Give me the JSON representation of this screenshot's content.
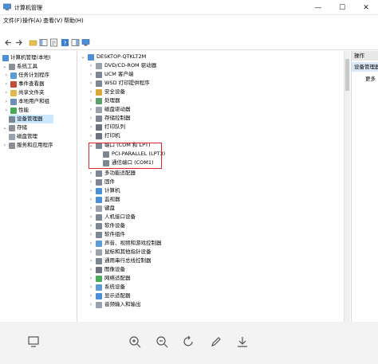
{
  "window": {
    "title": "计算机管理",
    "min_glyph": "—",
    "max_glyph": "☐",
    "close_glyph": "✕"
  },
  "menu": {
    "items": [
      "文件(F)",
      "操作(A)",
      "查看(V)",
      "帮助(H)"
    ]
  },
  "left_tree": {
    "items": [
      {
        "label": "计算机管理(本地)",
        "selected": false
      },
      {
        "label": "系统工具",
        "selected": false
      },
      {
        "label": "任务计划程序",
        "selected": false
      },
      {
        "label": "事件查看器",
        "selected": false
      },
      {
        "label": "共享文件夹",
        "selected": false
      },
      {
        "label": "本地用户和组",
        "selected": false
      },
      {
        "label": "性能",
        "selected": false
      },
      {
        "label": "设备管理器",
        "selected": true
      },
      {
        "label": "存储",
        "selected": false
      },
      {
        "label": "磁盘管理",
        "selected": false
      },
      {
        "label": "服务和应用程序",
        "selected": false
      }
    ]
  },
  "device_tree": {
    "root": "DESKTOP-QTKLT2M",
    "items": [
      "DVD/CD-ROM 驱动器",
      "UCM 客户端",
      "WSD 打印提供程序",
      "安全设备",
      "处理器",
      "磁盘驱动器",
      "存储控制器",
      "打印队列",
      "打印机",
      "端口 (COM 和 LPT)",
      "PCI-PARALLEL (LPT3)",
      "通信端口 (COM1)",
      "多功能适配器",
      "固件",
      "计算机",
      "监视器",
      "键盘",
      "人机接口设备",
      "软件设备",
      "软件组件",
      "声音、视频和游戏控制器",
      "鼠标和其他指针设备",
      "通用串行总线控制器",
      "图像设备",
      "网络适配器",
      "系统设备",
      "显示适配器",
      "音频输入和输出"
    ]
  },
  "actions_pane": {
    "header": "操作",
    "selected": "设备管理器",
    "more": "更多"
  },
  "colors": {
    "highlight_border": "#e0262c",
    "selection": "#cce8ff"
  }
}
